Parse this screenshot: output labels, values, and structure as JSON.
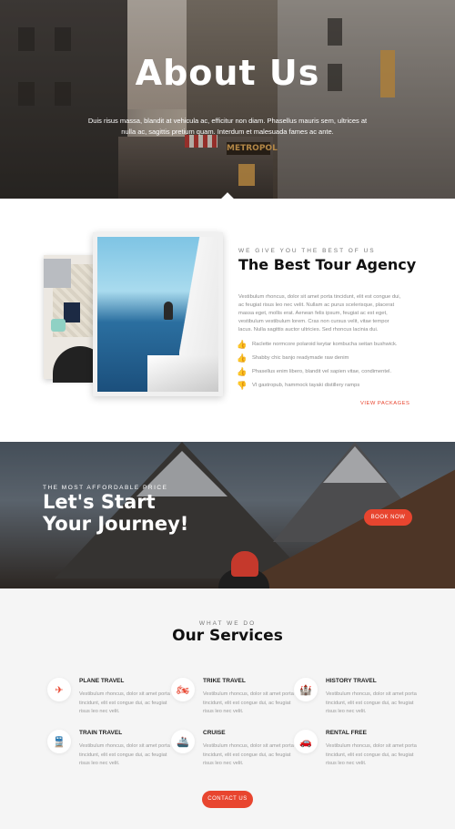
{
  "hero": {
    "title": "About Us",
    "description": "Duis risus massa, blandit at vehicula ac, efficitur non diam. Phasellus mauris sem, ultrices at nulla ac, sagittis pretium quam. Interdum et malesuada fames ac ante.",
    "shop_sign": "METROPOL"
  },
  "about": {
    "eyebrow": "WE GIVE YOU THE BEST OF US",
    "title": "The Best Tour Agency",
    "body": "Vestibulum rhoncus, dolor sit amet porta tincidunt, elit est congue dui, ac feugiat risus leo nec velit. Nullam ac purus scelerisque, placerat massa eget, mollis erat. Aenean felis ipsum, feugiat ac est eget, vestibulum vestibulum lorem. Cras non cursus velit, vitae tempor lacus. Nulla sagittis auctor ultricies. Sed rhoncus lacinia dui.",
    "features": [
      {
        "icon": "thumbs-up-icon",
        "text": "Raclette normcore polaroid keytar kombucha seitan bushwick."
      },
      {
        "icon": "thumbs-up-icon",
        "text": "Shabby chic banjo readymade raw denim"
      },
      {
        "icon": "thumbs-up-icon",
        "text": "Phasellus enim libero, blandit vel sapien vitae, condimentel."
      },
      {
        "icon": "thumbs-down-icon",
        "text": "VI gastropub, hammock tayaki distillery ramps"
      }
    ],
    "link": "VIEW PACKAGES"
  },
  "cta": {
    "eyebrow": "THE MOST AFFORDABLE PRICE",
    "title_line1": "Let's Start",
    "title_line2": "Your Journey!",
    "button": "BOOK NOW"
  },
  "services": {
    "eyebrow": "WHAT WE DO",
    "title": "Our Services",
    "items": [
      {
        "icon": "plane-icon",
        "title": "PLANE TRAVEL",
        "desc": "Vestibulum rhoncus, dolor sit amet porta tincidunt, elit est congue dui, ac feugiat risus leo nec velit."
      },
      {
        "icon": "motorbike-icon",
        "title": "TRIKE TRAVEL",
        "desc": "Vestibulum rhoncus, dolor sit amet porta tincidunt, elit est congue dui, ac feugiat risus leo nec velit."
      },
      {
        "icon": "castle-icon",
        "title": "HISTORY TRAVEL",
        "desc": "Vestibulum rhoncus, dolor sit amet porta tincidunt, elit est congue dui, ac feugiat risus leo nec velit."
      },
      {
        "icon": "train-icon",
        "title": "TRAIN TRAVEL",
        "desc": "Vestibulum rhoncus, dolor sit amet porta tincidunt, elit est congue dui, ac feugiat risus leo nec velit."
      },
      {
        "icon": "ship-icon",
        "title": "CRUISE",
        "desc": "Vestibulum rhoncus, dolor sit amet porta tincidunt, elit est congue dui, ac feugiat risus leo nec velit."
      },
      {
        "icon": "car-icon",
        "title": "RENTAL FREE",
        "desc": "Vestibulum rhoncus, dolor sit amet porta tincidunt, elit est congue dui, ac feugiat risus leo nec velit."
      }
    ],
    "button": "CONTACT US"
  },
  "colors": {
    "accent": "#e8452f",
    "services_bg": "#f5f5f5"
  }
}
